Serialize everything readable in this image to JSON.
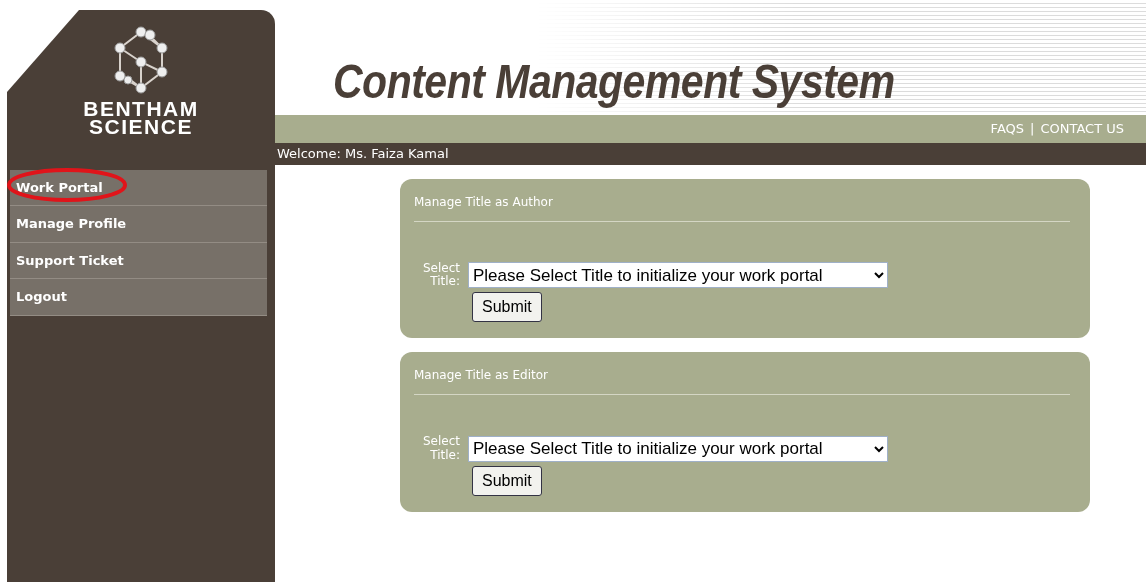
{
  "logo": {
    "lines": [
      "BENTHAM",
      "SCIENCE"
    ]
  },
  "header": {
    "title": "Content Management System",
    "links": [
      "FAQS",
      "CONTACT US"
    ],
    "separator": "|"
  },
  "welcome": "Welcome: Ms. Faiza Kamal",
  "sidebar": {
    "items": [
      {
        "label": "Work Portal",
        "circled": true
      },
      {
        "label": "Manage Profile",
        "circled": false
      },
      {
        "label": "Support Ticket",
        "circled": false
      },
      {
        "label": "Logout",
        "circled": false
      }
    ]
  },
  "panels": [
    {
      "heading": "Manage Title as Author",
      "select_label": "Select Title:",
      "select_value": "Please Select Title to initialize your work portal",
      "button": "Submit"
    },
    {
      "heading": "Manage Title as Editor",
      "select_label": "Select Title:",
      "select_value": "Please Select Title to initialize your work portal",
      "button": "Submit"
    }
  ]
}
